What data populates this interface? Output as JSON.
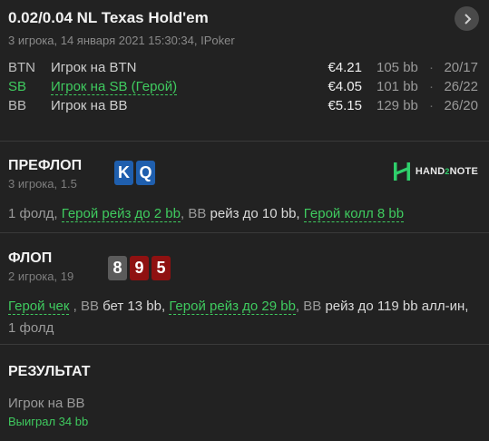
{
  "header": {
    "title": "0.02/0.04 NL Texas Hold'em",
    "subtitle": "3 игрока, 14 января 2021 15:30:34, IPoker"
  },
  "players": [
    {
      "pos": "BTN",
      "name": "Игрок на BTN",
      "stack": "€4.21",
      "bb": "105 bb",
      "sep": "·",
      "hands": "20/17",
      "hero": false
    },
    {
      "pos": "SB",
      "name": "Игрок на SB (Герой)",
      "stack": "€4.05",
      "bb": "101 bb",
      "sep": "·",
      "hands": "26/22",
      "hero": true
    },
    {
      "pos": "BB",
      "name": "Игрок на BB",
      "stack": "€5.15",
      "bb": "129 bb",
      "sep": "·",
      "hands": "26/20",
      "hero": false
    }
  ],
  "preflop": {
    "title": "ПРЕФЛОП",
    "sub": "3 игрока, 1.5",
    "cards": [
      {
        "rank": "K",
        "color": "#1f5fae"
      },
      {
        "rank": "Q",
        "color": "#1f5fae"
      }
    ],
    "actions": {
      "a1": "1 фолд,",
      "a2": "Герой рейз до 2 bb",
      "a3": ",",
      "a4": "BB",
      "a5": "рейз до 10 bb,",
      "a6": "Герой колл 8 bb"
    }
  },
  "flop": {
    "title": "ФЛОП",
    "sub": "2 игрока, 19",
    "cards": [
      {
        "rank": "8",
        "color": "#5b5b5b"
      },
      {
        "rank": "9",
        "color": "#8f1111"
      },
      {
        "rank": "5",
        "color": "#8f1111"
      }
    ],
    "actions": {
      "a1": "Герой чек",
      "a2": ",",
      "a3": "BB",
      "a4": "бет 13 bb,",
      "a5": "Герой рейз до 29 bb",
      "a6": ",",
      "a7": "BB",
      "a8": "рейз до 119 bb алл-ин,",
      "a9": "1 фолд"
    }
  },
  "result": {
    "title": "РЕЗУЛЬТАТ",
    "winner": "Игрок на BB",
    "won": "Выиграл 34 bb"
  },
  "logo": {
    "part1": "HAND",
    "part2": "2",
    "part3": "NOTE"
  },
  "colors": {
    "accent": "#3fcb5f",
    "background": "#222222"
  }
}
